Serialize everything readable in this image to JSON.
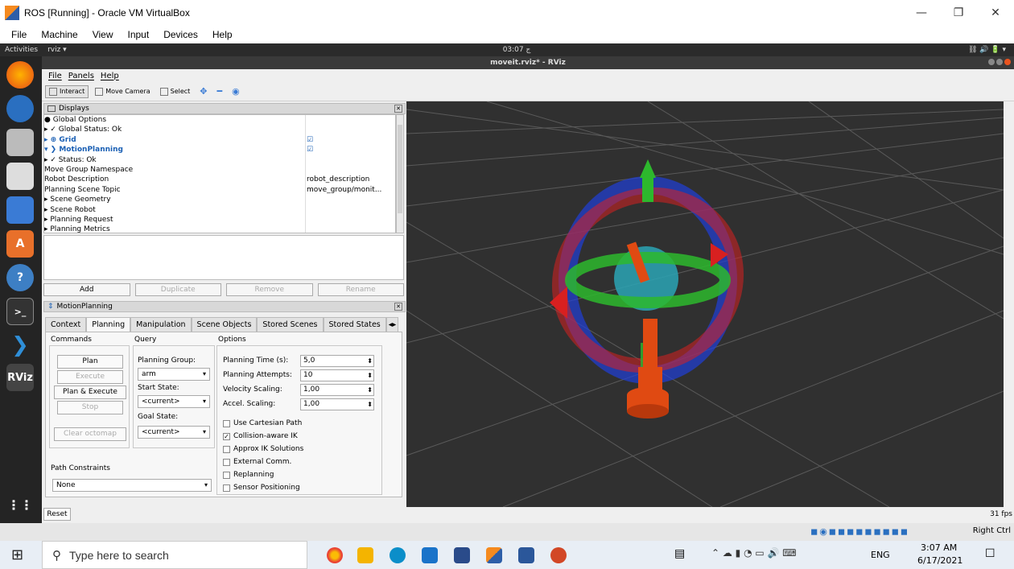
{
  "vbox": {
    "title": "ROS [Running] - Oracle VM VirtualBox",
    "menu": [
      "File",
      "Machine",
      "View",
      "Input",
      "Devices",
      "Help"
    ],
    "status_right": "Right Ctrl"
  },
  "ubuntu": {
    "activities": "Activities",
    "app": "rviz ▾",
    "clock": "03:07 ج"
  },
  "rviz": {
    "window_title": "moveit.rviz* - RViz",
    "menu": [
      "File",
      "Panels",
      "Help"
    ],
    "tools": [
      "Interact",
      "Move Camera",
      "Select"
    ],
    "displays_title": "Displays",
    "tree": [
      {
        "label": "● Global Options",
        "value": ""
      },
      {
        "label": "▸ ✓ Global Status: Ok",
        "value": ""
      },
      {
        "label": "▸ ⊕ Grid",
        "value": "☑"
      },
      {
        "label": "▾ ❯ MotionPlanning",
        "value": "☑"
      },
      {
        "label": "    ▸ ✓ Status: Ok",
        "value": ""
      },
      {
        "label": "    Move Group Namespace",
        "value": ""
      },
      {
        "label": "    Robot Description",
        "value": "robot_description"
      },
      {
        "label": "    Planning Scene Topic",
        "value": "move_group/monit..."
      },
      {
        "label": "    ▸ Scene Geometry",
        "value": ""
      },
      {
        "label": "    ▸ Scene Robot",
        "value": ""
      },
      {
        "label": "    ▸ Planning Request",
        "value": ""
      },
      {
        "label": "    ▸ Planning Metrics",
        "value": ""
      }
    ],
    "display_buttons": [
      "Add",
      "Duplicate",
      "Remove",
      "Rename"
    ],
    "mp_title": "MotionPlanning",
    "tabs": [
      "Context",
      "Planning",
      "Manipulation",
      "Scene Objects",
      "Stored Scenes",
      "Stored States"
    ],
    "commands": {
      "title": "Commands",
      "plan": "Plan",
      "execute": "Execute",
      "plan_execute": "Plan & Execute",
      "stop": "Stop",
      "clear": "Clear octomap"
    },
    "query": {
      "title": "Query",
      "group_label": "Planning Group:",
      "group_value": "arm",
      "start_label": "Start State:",
      "start_value": "<current>",
      "goal_label": "Goal State:",
      "goal_value": "<current>"
    },
    "options": {
      "title": "Options",
      "time_label": "Planning Time (s):",
      "time_value": "5,0",
      "attempts_label": "Planning Attempts:",
      "attempts_value": "10",
      "velocity_label": "Velocity Scaling:",
      "velocity_value": "1,00",
      "accel_label": "Accel. Scaling:",
      "accel_value": "1,00",
      "checks": [
        {
          "label": "Use Cartesian Path",
          "checked": false
        },
        {
          "label": "Collision-aware IK",
          "checked": true
        },
        {
          "label": "Approx IK Solutions",
          "checked": false
        },
        {
          "label": "External Comm.",
          "checked": false
        },
        {
          "label": "Replanning",
          "checked": false
        },
        {
          "label": "Sensor Positioning",
          "checked": false
        }
      ]
    },
    "path_constraints": "Path Constraints",
    "path_value": "None",
    "reset": "Reset",
    "fps": "31 fps"
  },
  "taskbar": {
    "search": "Type here to search",
    "lang": "ENG",
    "time": "3:07 AM",
    "date": "6/17/2021"
  }
}
